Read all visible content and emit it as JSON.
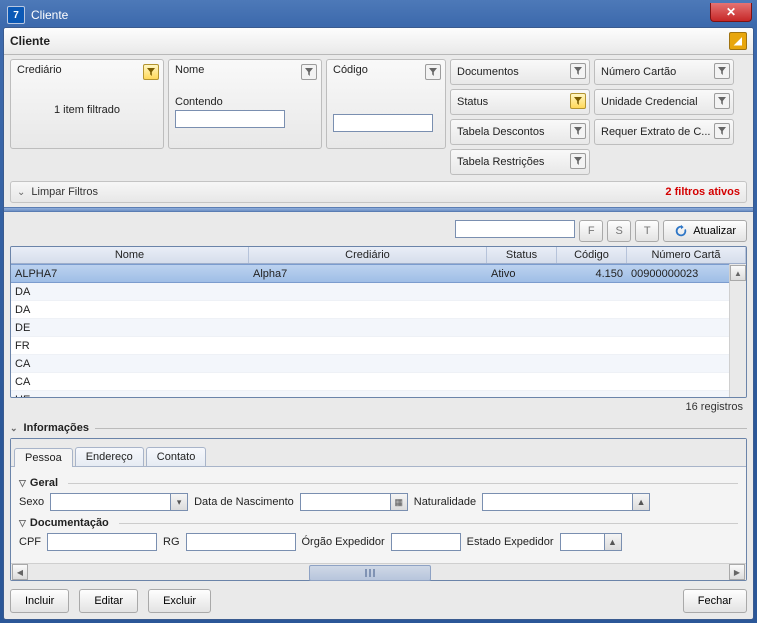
{
  "window": {
    "title": "Cliente"
  },
  "header": {
    "title": "Cliente"
  },
  "filters": {
    "crediario": {
      "label": "Crediário",
      "summary": "1 item filtrado"
    },
    "nome": {
      "label": "Nome",
      "contendo_label": "Contendo",
      "value": ""
    },
    "codigo": {
      "label": "Código",
      "value": ""
    },
    "side_col1": [
      {
        "label": "Documentos",
        "active": false
      },
      {
        "label": "Status",
        "active": true
      },
      {
        "label": "Tabela Descontos",
        "active": false
      },
      {
        "label": "Tabela Restrições",
        "active": false
      }
    ],
    "side_col2": [
      {
        "label": "Número Cartão",
        "active": false
      },
      {
        "label": "Unidade Credencial",
        "active": false
      },
      {
        "label": "Requer Extrato de C...",
        "active": false
      }
    ],
    "limpar": "Limpar Filtros",
    "active_count_text": "2 filtros ativos"
  },
  "toolbar": {
    "search_value": "",
    "btns": {
      "f": "F",
      "s": "S",
      "t": "T"
    },
    "refresh": "Atualizar"
  },
  "table": {
    "columns": [
      "Nome",
      "Crediário",
      "Status",
      "Código",
      "Número Cartã"
    ],
    "rows": [
      {
        "nome": "ALPHA7",
        "crediario": "Alpha7",
        "status": "Ativo",
        "codigo": "4.150",
        "cartao": "00900000023",
        "selected": true
      },
      {
        "nome": "DA",
        "crediario": "",
        "status": "",
        "codigo": "",
        "cartao": ""
      },
      {
        "nome": "DA",
        "crediario": "",
        "status": "",
        "codigo": "",
        "cartao": ""
      },
      {
        "nome": "DE",
        "crediario": "",
        "status": "",
        "codigo": "",
        "cartao": ""
      },
      {
        "nome": "FR",
        "crediario": "",
        "status": "",
        "codigo": "",
        "cartao": ""
      },
      {
        "nome": "CA",
        "crediario": "",
        "status": "",
        "codigo": "",
        "cartao": ""
      },
      {
        "nome": "CA",
        "crediario": "",
        "status": "",
        "codigo": "",
        "cartao": ""
      },
      {
        "nome": "HE",
        "crediario": "",
        "status": "",
        "codigo": "",
        "cartao": ""
      }
    ],
    "status": "16 registros"
  },
  "info": {
    "title": "Informações",
    "tabs": {
      "pessoa": "Pessoa",
      "endereco": "Endereço",
      "contato": "Contato"
    },
    "geral": {
      "title": "Geral",
      "sexo_label": "Sexo",
      "nasc_label": "Data de Nascimento",
      "nat_label": "Naturalidade"
    },
    "doc": {
      "title": "Documentação",
      "cpf_label": "CPF",
      "rg_label": "RG",
      "orgao_label": "Órgão Expedidor",
      "estado_label": "Estado Expedidor"
    }
  },
  "footer": {
    "incluir": "Incluir",
    "editar": "Editar",
    "excluir": "Excluir",
    "fechar": "Fechar"
  }
}
